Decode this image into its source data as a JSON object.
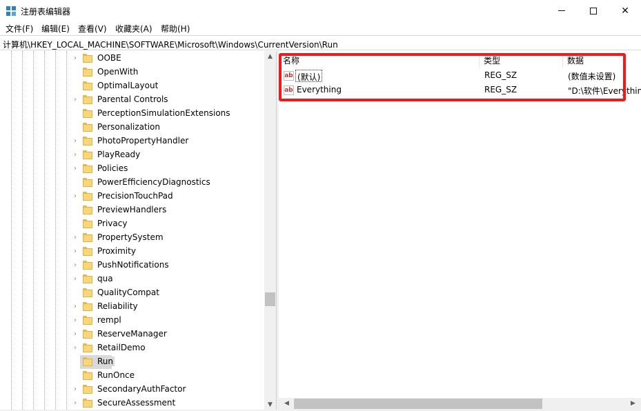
{
  "window": {
    "title": "注册表编辑器",
    "minimize_label": "",
    "maximize_label": "",
    "close_label": "✕"
  },
  "menu": {
    "items": [
      {
        "label": "文件(F)"
      },
      {
        "label": "编辑(E)"
      },
      {
        "label": "查看(V)"
      },
      {
        "label": "收藏夹(A)"
      },
      {
        "label": "帮助(H)"
      }
    ]
  },
  "address": {
    "path": "计算机\\HKEY_LOCAL_MACHINE\\SOFTWARE\\Microsoft\\Windows\\CurrentVersion\\Run"
  },
  "tree": {
    "items": [
      {
        "label": "OOBE",
        "expandable": true,
        "selected": false
      },
      {
        "label": "OpenWith",
        "expandable": false,
        "selected": false
      },
      {
        "label": "OptimalLayout",
        "expandable": false,
        "selected": false
      },
      {
        "label": "Parental Controls",
        "expandable": true,
        "selected": false
      },
      {
        "label": "PerceptionSimulationExtensions",
        "expandable": false,
        "selected": false
      },
      {
        "label": "Personalization",
        "expandable": false,
        "selected": false
      },
      {
        "label": "PhotoPropertyHandler",
        "expandable": true,
        "selected": false
      },
      {
        "label": "PlayReady",
        "expandable": true,
        "selected": false
      },
      {
        "label": "Policies",
        "expandable": true,
        "selected": false
      },
      {
        "label": "PowerEfficiencyDiagnostics",
        "expandable": false,
        "selected": false
      },
      {
        "label": "PrecisionTouchPad",
        "expandable": true,
        "selected": false
      },
      {
        "label": "PreviewHandlers",
        "expandable": false,
        "selected": false
      },
      {
        "label": "Privacy",
        "expandable": false,
        "selected": false
      },
      {
        "label": "PropertySystem",
        "expandable": true,
        "selected": false
      },
      {
        "label": "Proximity",
        "expandable": true,
        "selected": false
      },
      {
        "label": "PushNotifications",
        "expandable": true,
        "selected": false
      },
      {
        "label": "qua",
        "expandable": true,
        "selected": false
      },
      {
        "label": "QualityCompat",
        "expandable": false,
        "selected": false
      },
      {
        "label": "Reliability",
        "expandable": true,
        "selected": false
      },
      {
        "label": "rempl",
        "expandable": true,
        "selected": false
      },
      {
        "label": "ReserveManager",
        "expandable": true,
        "selected": false
      },
      {
        "label": "RetailDemo",
        "expandable": true,
        "selected": false
      },
      {
        "label": "Run",
        "expandable": false,
        "selected": true
      },
      {
        "label": "RunOnce",
        "expandable": false,
        "selected": false
      },
      {
        "label": "SecondaryAuthFactor",
        "expandable": true,
        "selected": false
      },
      {
        "label": "SecureAssessment",
        "expandable": true,
        "selected": false
      }
    ]
  },
  "values": {
    "columns": {
      "name": "名称",
      "type": "类型",
      "data": "数据"
    },
    "rows": [
      {
        "name": "(默认)",
        "type": "REG_SZ",
        "data": "(数值未设置)",
        "icon": "string-value-icon",
        "focused": true
      },
      {
        "name": "Everything",
        "type": "REG_SZ",
        "data": "\"D:\\软件\\Everything",
        "icon": "string-value-icon",
        "focused": false
      }
    ]
  },
  "icons": {
    "value_icon_text": "ab",
    "up_arrow": "▲",
    "down_arrow": "▼",
    "left_arrow": "◀",
    "right_arrow": "▶",
    "expander": "›"
  },
  "colors": {
    "highlight_box": "#f01818",
    "folder": "#f6d77a",
    "selection": "#d9d9d9"
  }
}
